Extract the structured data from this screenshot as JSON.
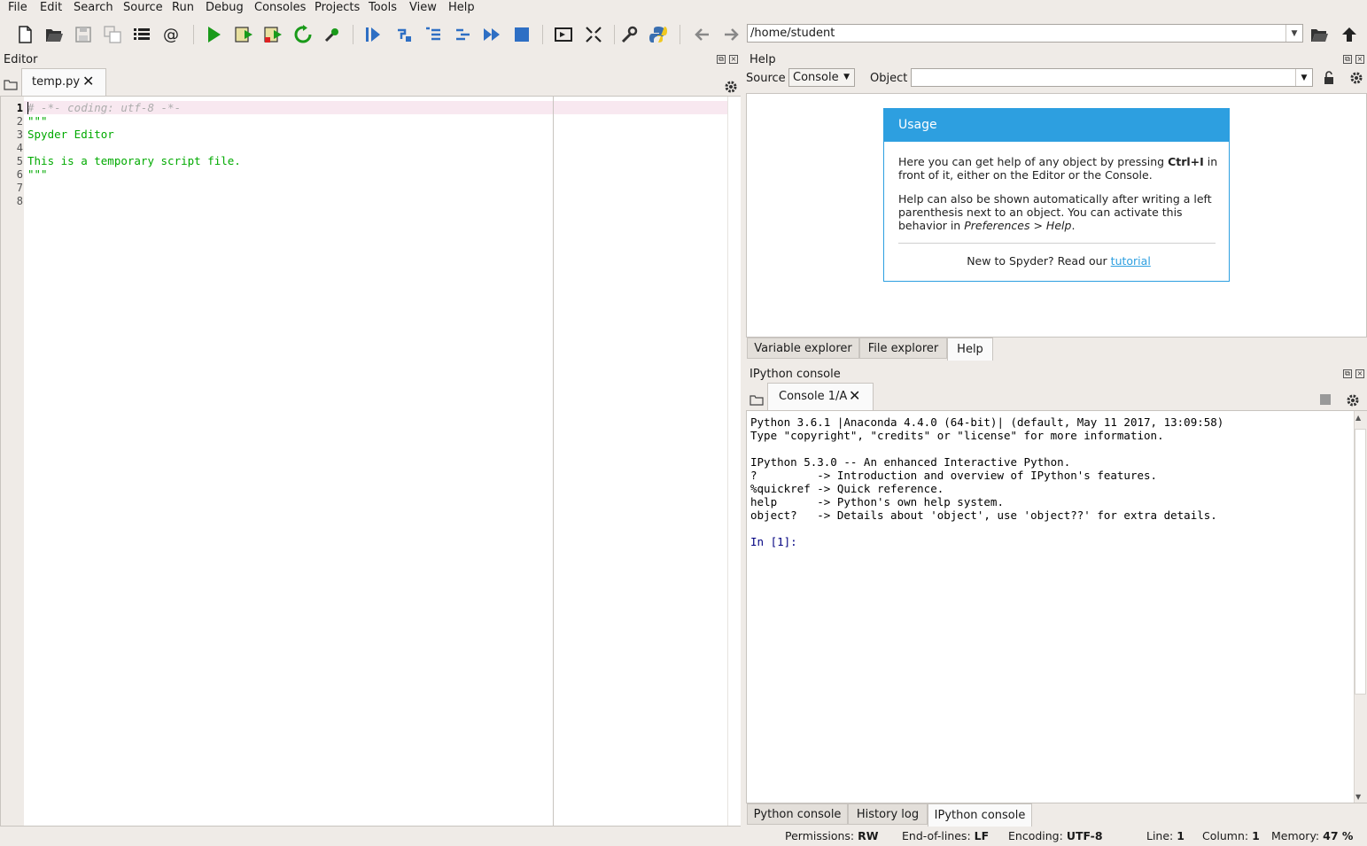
{
  "menu": [
    "File",
    "Edit",
    "Search",
    "Source",
    "Run",
    "Debug",
    "Consoles",
    "Projects",
    "Tools",
    "View",
    "Help"
  ],
  "toolbar": {
    "path": "/home/student",
    "icons": [
      "new-file-icon",
      "open-file-icon",
      "save-icon",
      "save-all-icon",
      "outline-icon",
      "at-icon",
      "run-icon",
      "run-cell-icon",
      "run-cell-advance-icon",
      "rerun-icon",
      "configure-run-icon",
      "debug-icon",
      "step-icon",
      "step-into-icon",
      "step-return-icon",
      "continue-icon",
      "stop-icon",
      "maximize-pane-icon",
      "fullscreen-icon",
      "preferences-icon",
      "python-path-icon",
      "back-arrow-icon",
      "forward-arrow-icon",
      "browse-folder-icon",
      "parent-dir-icon"
    ]
  },
  "editor": {
    "title": "Editor",
    "tab": "temp.py",
    "lines": [
      {
        "n": "1",
        "text": "# -*- coding: utf-8 -*-"
      },
      {
        "n": "2",
        "text": "\"\"\""
      },
      {
        "n": "3",
        "text": "Spyder Editor"
      },
      {
        "n": "4",
        "text": ""
      },
      {
        "n": "5",
        "text": "This is a temporary script file."
      },
      {
        "n": "6",
        "text": "\"\"\""
      },
      {
        "n": "7",
        "text": ""
      },
      {
        "n": "8",
        "text": ""
      }
    ]
  },
  "help": {
    "title": "Help",
    "source_label": "Source",
    "source_value": "Console",
    "object_label": "Object",
    "object_value": "",
    "usage": {
      "heading": "Usage",
      "p1_a": "Here you can get help of any object by pressing ",
      "p1_key": "Ctrl+I",
      "p1_b": " in front of it, either on the Editor or the Console.",
      "p2_a": "Help can also be shown automatically after writing a left parenthesis next to an object. You can activate this behavior in ",
      "p2_em": "Preferences > Help",
      "p2_b": ".",
      "footer_a": "New to Spyder? Read our ",
      "footer_link": "tutorial"
    },
    "tabs": [
      "Variable explorer",
      "File explorer",
      "Help"
    ]
  },
  "console": {
    "title": "IPython console",
    "tab": "Console 1/A",
    "lines": [
      "Python 3.6.1 |Anaconda 4.4.0 (64-bit)| (default, May 11 2017, 13:09:58)",
      "Type \"copyright\", \"credits\" or \"license\" for more information.",
      "",
      "IPython 5.3.0 -- An enhanced Interactive Python.",
      "?         -> Introduction and overview of IPython's features.",
      "%quickref -> Quick reference.",
      "help      -> Python's own help system.",
      "object?   -> Details about 'object', use 'object??' for extra details."
    ],
    "prompt": "In [1]:",
    "tabs": [
      "Python console",
      "History log",
      "IPython console"
    ]
  },
  "status": {
    "permissions_label": "Permissions:",
    "permissions": "RW",
    "eol_label": "End-of-lines:",
    "eol": "LF",
    "encoding_label": "Encoding:",
    "encoding": "UTF-8",
    "line_label": "Line:",
    "line": "1",
    "column_label": "Column:",
    "column": "1",
    "memory_label": "Memory:",
    "memory": "47 %"
  },
  "colors": {
    "accent": "#2d9fe0",
    "string": "#00aa00",
    "comment": "#adadad",
    "prompt": "#000080"
  }
}
